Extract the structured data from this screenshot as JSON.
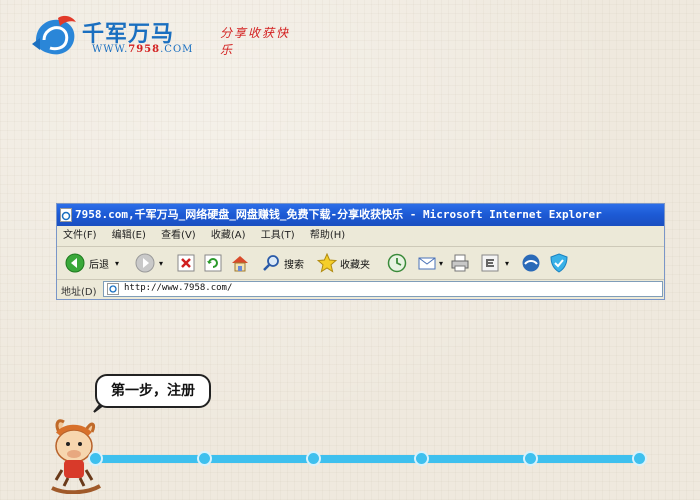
{
  "logo": {
    "name": "千军万马",
    "url_prefix": "WWW.",
    "url_number": "7958",
    "url_suffix": ".COM",
    "slogan": "分享收获快乐"
  },
  "browser": {
    "title": "7958.com,千军万马_网络硬盘_网盘赚钱_免费下载-分享收获快乐 - Microsoft Internet Explorer",
    "menu": [
      "文件(F)",
      "编辑(E)",
      "查看(V)",
      "收藏(A)",
      "工具(T)",
      "帮助(H)"
    ],
    "toolbar": {
      "back_label": "后退",
      "search_label": "搜索",
      "favorites_label": "收藏夹"
    },
    "address": {
      "label": "地址(D)",
      "value": "http://www.7958.com/"
    }
  },
  "step": {
    "text": "第一步，注册"
  },
  "progress": {
    "total_steps": 6,
    "current_step": 1
  },
  "colors": {
    "track": "#3ec0ee",
    "titlebar": "#1d5bd6",
    "brand_blue": "#1a6fc0",
    "brand_red": "#d32020"
  }
}
